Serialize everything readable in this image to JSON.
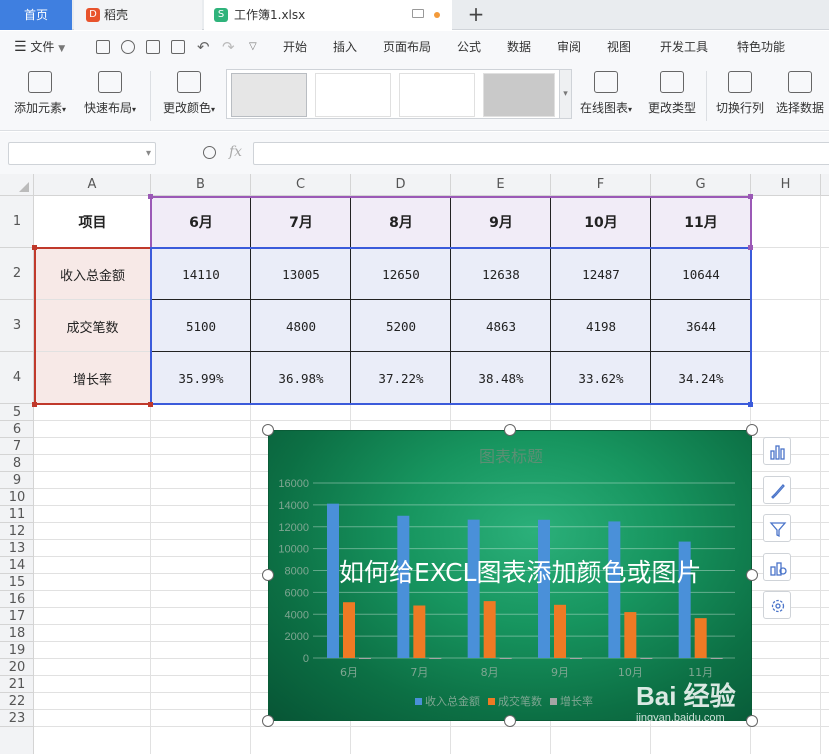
{
  "tabs": {
    "home": "首页",
    "daoke": "稻壳",
    "workbook": "工作簿1.xlsx",
    "new_tab": "+"
  },
  "menu": {
    "file": "文件",
    "items": [
      "开始",
      "插入",
      "页面布局",
      "公式",
      "数据",
      "审阅",
      "视图",
      "开发工具",
      "特色功能"
    ]
  },
  "ribbon": {
    "add_element": "添加元素",
    "quick_layout": "快速布局",
    "change_color": "更改颜色",
    "online_chart": "在线图表",
    "change_type": "更改类型",
    "switch_row_col": "切换行列",
    "select_data": "选择数据"
  },
  "formula_bar": {
    "name_box": "",
    "fx": "fx",
    "formula": ""
  },
  "columns": [
    "A",
    "B",
    "C",
    "D",
    "E",
    "F",
    "G",
    "H"
  ],
  "rows": [
    "1",
    "2",
    "3",
    "4",
    "5",
    "6",
    "7",
    "8",
    "9",
    "10",
    "11",
    "12",
    "13",
    "14",
    "15",
    "16",
    "17",
    "18",
    "19",
    "20",
    "21",
    "22",
    "23"
  ],
  "table": {
    "header": [
      "项目",
      "6月",
      "7月",
      "8月",
      "9月",
      "10月",
      "11月"
    ],
    "rows": [
      [
        "收入总金额",
        "14110",
        "13005",
        "12650",
        "12638",
        "12487",
        "10644"
      ],
      [
        "成交笔数",
        "5100",
        "4800",
        "5200",
        "4863",
        "4198",
        "3644"
      ],
      [
        "增长率",
        "35.99%",
        "36.98%",
        "37.22%",
        "38.48%",
        "33.62%",
        "34.24%"
      ]
    ]
  },
  "chart_data": {
    "type": "bar",
    "title": "图表标题",
    "categories": [
      "6月",
      "7月",
      "8月",
      "9月",
      "10月",
      "11月"
    ],
    "series": [
      {
        "name": "收入总金额",
        "values": [
          14110,
          13005,
          12650,
          12638,
          12487,
          10644
        ],
        "color": "#4a90d9"
      },
      {
        "name": "成交笔数",
        "values": [
          5100,
          4800,
          5200,
          4863,
          4198,
          3644
        ],
        "color": "#ee7a24"
      },
      {
        "name": "增长率",
        "values": [
          0.3599,
          0.3698,
          0.3722,
          0.3848,
          0.3362,
          0.3424
        ],
        "color": "#a5a5a5"
      }
    ],
    "y_ticks": [
      "0",
      "2000",
      "4000",
      "6000",
      "8000",
      "10000",
      "12000",
      "14000",
      "16000"
    ],
    "ylim": [
      0,
      16000
    ],
    "legend_position": "bottom",
    "gridlines": true
  },
  "overlay_text": "如何给EXCL图表添加颜色或图片",
  "watermark": {
    "brand": "Bai 经验",
    "url": "jingyan.baidu.com"
  },
  "colors": {
    "tab_active": "#3f7fe0",
    "header_fill": "#f1ecf7",
    "label_fill": "#f7e9e7",
    "data_fill": "#eaedf8",
    "purple_border": "#9b59b6",
    "red_border": "#c0392b",
    "blue_border": "#3b5bdb"
  }
}
